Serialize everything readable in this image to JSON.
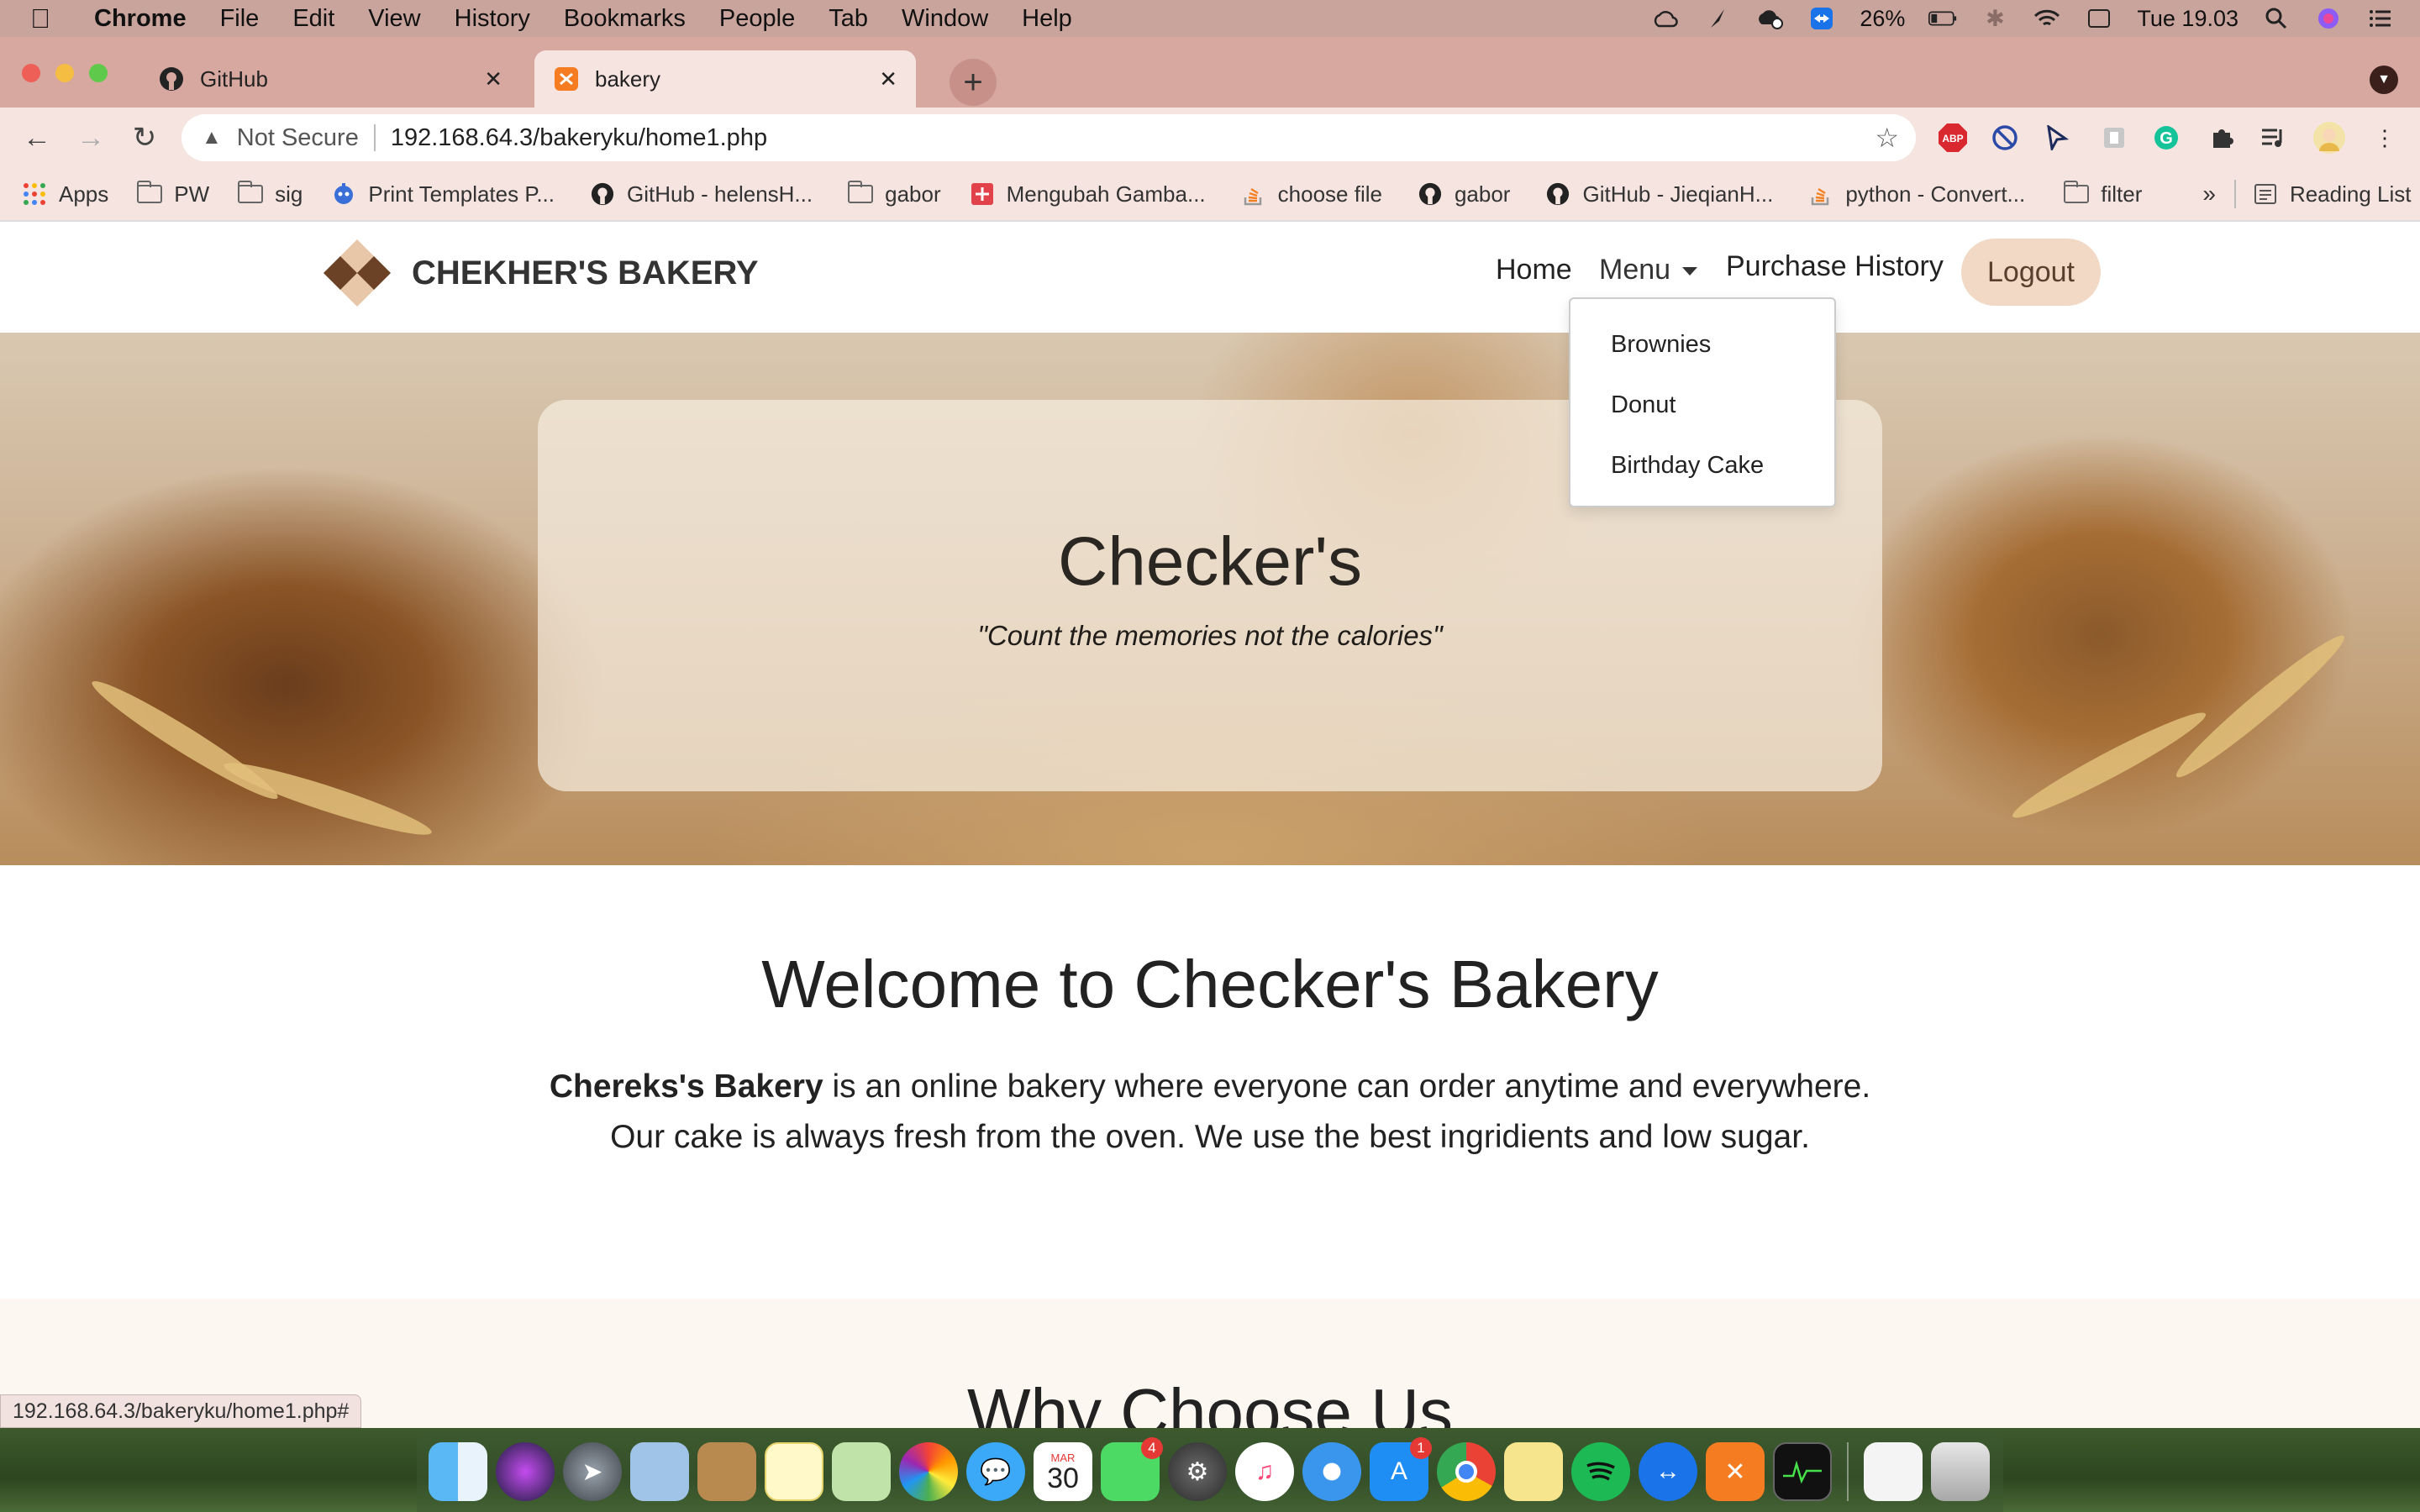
{
  "menubar": {
    "app_name": "Chrome",
    "items": [
      "File",
      "Edit",
      "View",
      "History",
      "Bookmarks",
      "People",
      "Tab",
      "Window",
      "Help"
    ],
    "battery": "26%",
    "clock": "Tue 19.03"
  },
  "tabs": [
    {
      "title": "GitHub",
      "favicon": "github-icon"
    },
    {
      "title": "bakery",
      "favicon": "xampp-icon"
    }
  ],
  "omnibox": {
    "security_label": "Not Secure",
    "url": "192.168.64.3/bakeryku/home1.php"
  },
  "bookmarks": [
    {
      "label": "Apps",
      "icon": "apps-grid-icon"
    },
    {
      "label": "PW",
      "icon": "folder-icon"
    },
    {
      "label": "sig",
      "icon": "folder-icon"
    },
    {
      "label": "Print Templates P...",
      "icon": "site-icon"
    },
    {
      "label": "GitHub - helensH...",
      "icon": "github-icon"
    },
    {
      "label": "gabor",
      "icon": "folder-icon"
    },
    {
      "label": "Mengubah Gamba...",
      "icon": "site-icon"
    },
    {
      "label": "choose file",
      "icon": "stackoverflow-icon"
    },
    {
      "label": "gabor",
      "icon": "github-icon"
    },
    {
      "label": "GitHub - JieqianH...",
      "icon": "github-icon"
    },
    {
      "label": "python - Convert...",
      "icon": "stackoverflow-icon"
    },
    {
      "label": "filter",
      "icon": "folder-icon"
    }
  ],
  "bookmarks_overflow": "»",
  "reading_list": "Reading List",
  "site": {
    "brand": "CHEKHER'S BAKERY",
    "nav": {
      "home": "Home",
      "menu": "Menu",
      "history": "Purchase History",
      "logout": "Logout"
    },
    "menu_items": [
      "Brownies",
      "Donut",
      "Birthday Cake"
    ],
    "hero": {
      "title": "Checker's",
      "subtitle": "\"Count the memories not the calories\""
    },
    "welcome": {
      "heading": "Welcome to Checker's Bakery",
      "bold": "Chereks's Bakery",
      "line1_rest": " is  an online bakery where everyone can order anytime and everywhere.",
      "line2": "Our cake is always fresh from the oven. We use the best ingridients and low sugar."
    },
    "next_section_heading": "Why Choose Us"
  },
  "status_bar_url": "192.168.64.3/bakeryku/home1.php#",
  "dock": {
    "calendar_month": "MAR",
    "calendar_day": "30",
    "facetime_badge": "4",
    "appstore_badge": "1"
  },
  "colors": {
    "chrome_tabstrip": "#d7a8a0",
    "chrome_toolbar": "#f6e4e1",
    "logout_button": "#f1d9c6",
    "brand_logo": "#6b4226"
  }
}
